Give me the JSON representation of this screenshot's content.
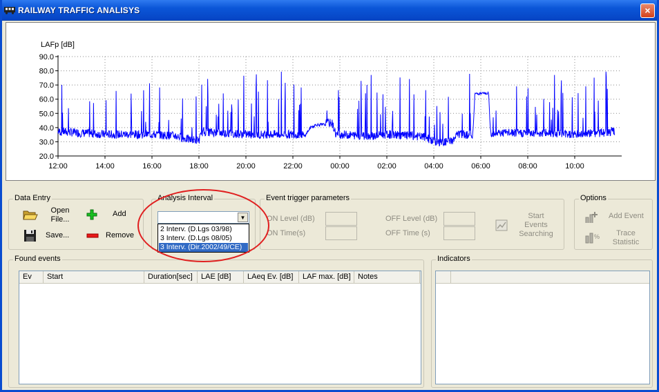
{
  "window": {
    "title": "RAILWAY TRAFFIC ANALISYS",
    "close_label": "×"
  },
  "chart_data": {
    "type": "line",
    "ylabel": "LAFp [dB]",
    "ylim": [
      20,
      90
    ],
    "yticks": [
      "20.0",
      "30.0",
      "40.0",
      "50.0",
      "60.0",
      "70.0",
      "80.0",
      "90.0"
    ],
    "xticks": [
      "12:00",
      "14:00",
      "16:00",
      "18:00",
      "20:00",
      "22:00",
      "00:00",
      "02:00",
      "04:00",
      "06:00",
      "08:00",
      "10:00"
    ],
    "grid": true,
    "color": "#0000ff",
    "series": [
      {
        "baseline": [
          {
            "t": "12:00",
            "v": 36
          },
          {
            "t": "13:00",
            "v": 35
          },
          {
            "t": "14:00",
            "v": 34
          },
          {
            "t": "15:00",
            "v": 34
          },
          {
            "t": "16:00",
            "v": 34
          },
          {
            "t": "17:00",
            "v": 33
          },
          {
            "t": "17:40",
            "v": 30
          },
          {
            "t": "18:00",
            "v": 30
          },
          {
            "t": "18:10",
            "v": 36
          },
          {
            "t": "19:00",
            "v": 35
          },
          {
            "t": "20:00",
            "v": 34
          },
          {
            "t": "21:00",
            "v": 34
          },
          {
            "t": "22:00",
            "v": 34
          },
          {
            "t": "22:30",
            "v": 34
          },
          {
            "t": "22:45",
            "v": 40
          },
          {
            "t": "23:00",
            "v": 42
          },
          {
            "t": "23:40",
            "v": 42
          },
          {
            "t": "23:50",
            "v": 34
          },
          {
            "t": "00:00",
            "v": 34
          },
          {
            "t": "01:00",
            "v": 33
          },
          {
            "t": "01:30",
            "v": 33
          },
          {
            "t": "02:00",
            "v": 34
          },
          {
            "t": "03:00",
            "v": 33
          },
          {
            "t": "03:40",
            "v": 32
          },
          {
            "t": "04:00",
            "v": 29
          },
          {
            "t": "04:20",
            "v": 28
          },
          {
            "t": "04:50",
            "v": 30
          },
          {
            "t": "05:00",
            "v": 34
          },
          {
            "t": "05:40",
            "v": 34
          },
          {
            "t": "05:45",
            "v": 64
          },
          {
            "t": "06:20",
            "v": 64
          },
          {
            "t": "06:25",
            "v": 35
          },
          {
            "t": "07:00",
            "v": 35
          },
          {
            "t": "08:00",
            "v": 35
          },
          {
            "t": "09:00",
            "v": 35
          },
          {
            "t": "10:00",
            "v": 34
          },
          {
            "t": "11:00",
            "v": 35
          },
          {
            "t": "11:40",
            "v": 36
          }
        ]
      }
    ]
  },
  "data_entry": {
    "legend": "Data Entry",
    "open_label": "Open File...",
    "save_label": "Save...",
    "add_label": "Add",
    "remove_label": "Remove"
  },
  "analysis": {
    "legend": "Analysis Interval",
    "selected": "",
    "options": [
      "2 Interv. (D.Lgs 03/98)",
      "3 Interv. (D.Lgs 08/05)",
      "3 Interv. (Dir.2002/49/CE)"
    ]
  },
  "event_trigger": {
    "legend": "Event trigger parameters",
    "on_level": "ON Level (dB)",
    "on_time": "ON Time(s)",
    "off_level": "OFF Level (dB)",
    "off_time": "OFF Time (s)",
    "start_search": "Start Events Searching"
  },
  "options": {
    "legend": "Options",
    "add_event": "Add Event",
    "trace_statistic": "Trace Statistic"
  },
  "found_events": {
    "legend": "Found events",
    "columns": [
      "Ev",
      "Start",
      "Duration[sec]",
      "LAE [dB]",
      "LAeq Ev. [dB]",
      "LAF max. [dB]",
      "Notes"
    ]
  },
  "indicators": {
    "legend": "Indicators"
  },
  "colors": {
    "titlebar": "#0b56d8",
    "series": "#0000ff",
    "annotation": "#e02020",
    "selection": "#316ac5"
  }
}
